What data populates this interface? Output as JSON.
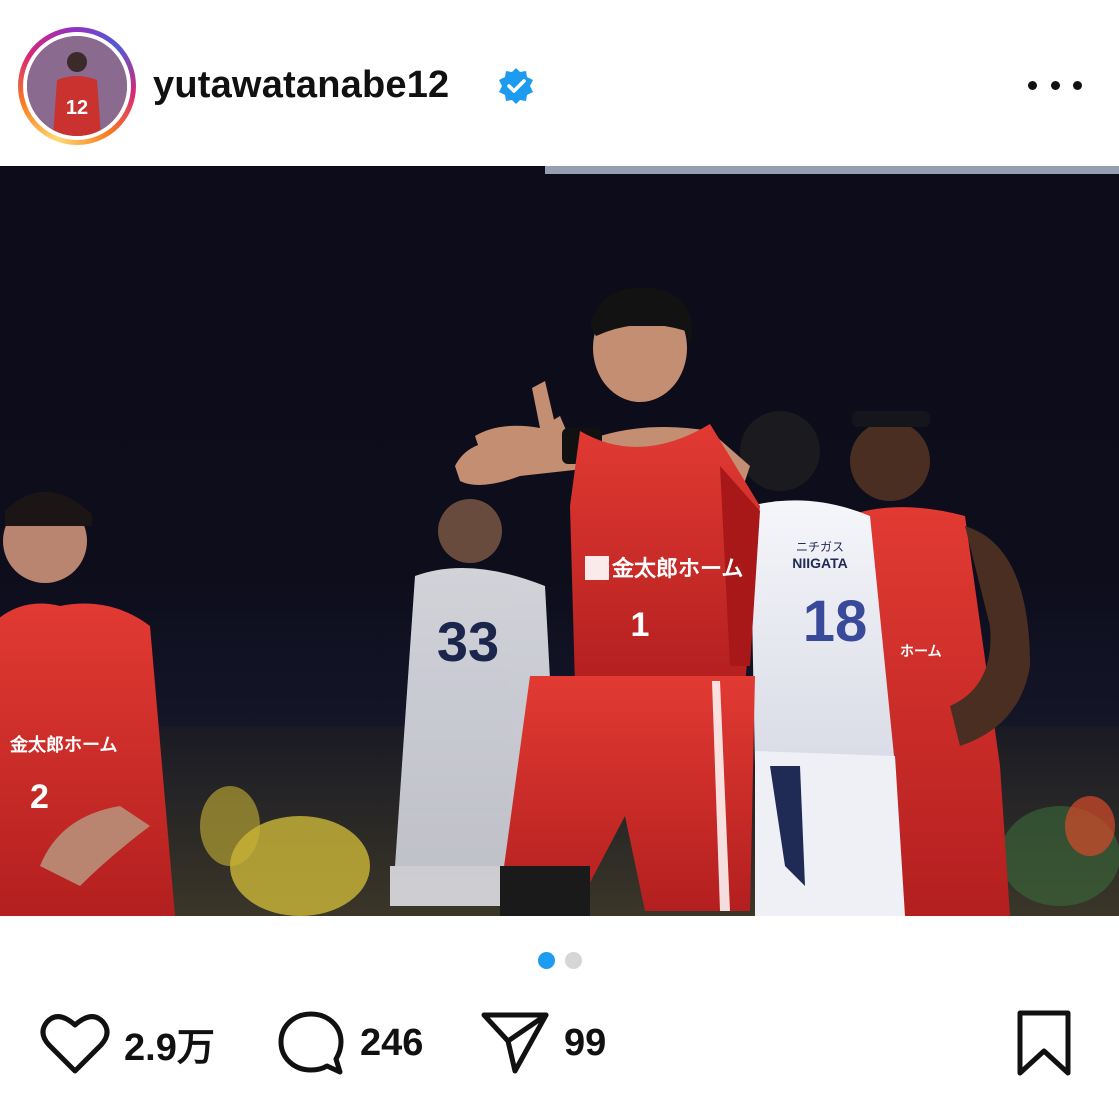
{
  "post": {
    "username": "yutawatanabe12",
    "verified": true,
    "photo_description_icon": "photo",
    "avatar": {
      "jersey_number": "12"
    }
  },
  "carousel": {
    "total": 2,
    "active_index": 0
  },
  "actions": {
    "likes": "2.9万",
    "comments": "246",
    "shares": "99"
  },
  "photo_text": {
    "center_number": "1",
    "center_sponsor": "金太郎ホーム",
    "left_number": "2",
    "left_sponsor": "金太郎ホーム",
    "away_number_mid": "33",
    "away_number_right": "18",
    "away_sponsor": "NIIGATA",
    "away_sponsor_small": "ニチガス"
  },
  "colors": {
    "verified": "#1d9bf0",
    "carousel_active": "#1d9bf0",
    "carousel_inactive": "#d6d6d6",
    "home_jersey": "#d42a2a",
    "away_jersey": "#f2f2f6"
  }
}
